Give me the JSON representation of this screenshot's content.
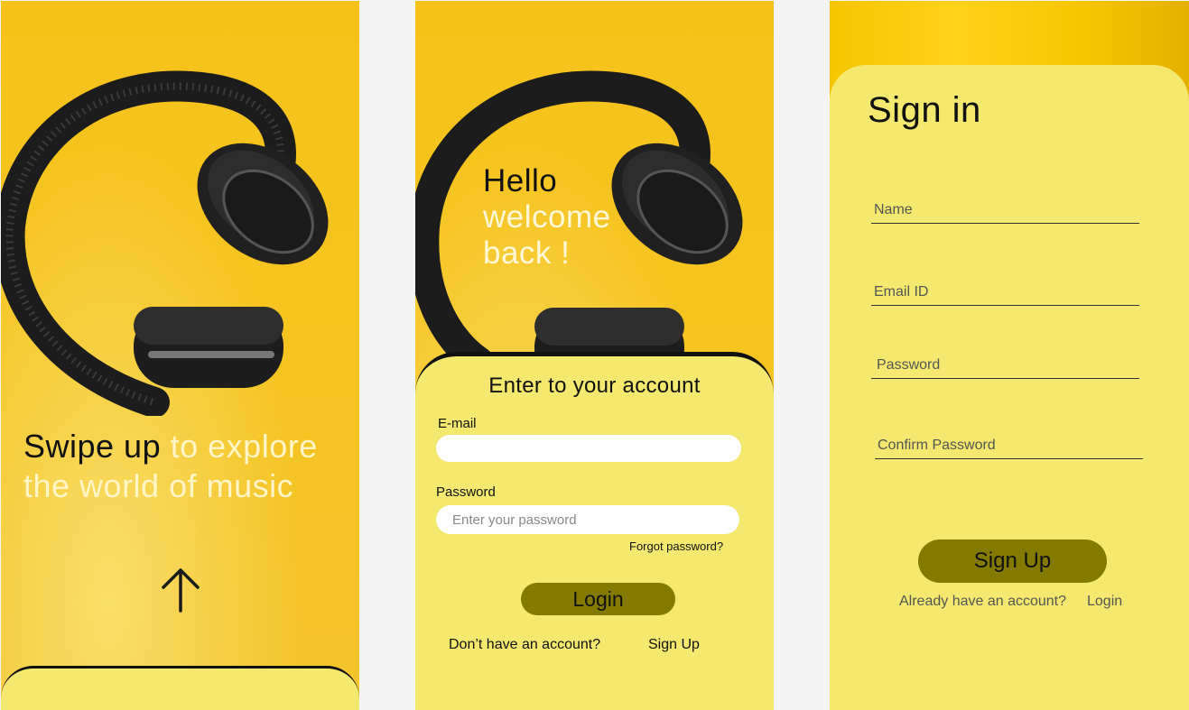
{
  "screens": {
    "swipe": {
      "tagline_dark": "Swipe up",
      "tagline_light": "to explore the world of music",
      "arrow_icon": "arrow-up-icon"
    },
    "login": {
      "hello": "Hello",
      "welcome": "welcome",
      "back": "back !",
      "card_title": "Enter to your account",
      "email_label": "E-mail",
      "email_placeholder": "",
      "password_label": "Password",
      "password_placeholder": "Enter your password",
      "forgot_password": "Forgot password?",
      "login_button": "Login",
      "no_account_text": "Don’t have an account?",
      "signup_link": "Sign Up"
    },
    "signin": {
      "title": "Sign in",
      "name_placeholder": "Name",
      "email_placeholder": "Email ID",
      "password_placeholder": "Password",
      "confirm_password_placeholder": "Confirm Password",
      "signup_button": "Sign Up",
      "have_account_text": "Already have an account?",
      "login_link": "Login"
    }
  },
  "colors": {
    "background": "#f4f4f4",
    "photo_yellow": "#f6c21a",
    "card_yellow": "#f5e86e",
    "button_olive": "#857a00",
    "text_dark": "#111111"
  }
}
